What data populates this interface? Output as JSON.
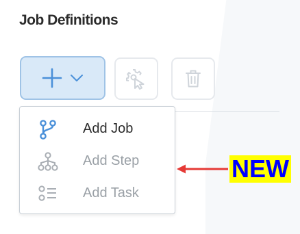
{
  "header": {
    "title": "Job Definitions"
  },
  "toolbar": {
    "add_button": {
      "icon": "plus-icon",
      "dropdown_icon": "chevron-down-icon",
      "color": "#4a90d9"
    },
    "settings_button": {
      "icon": "gear-arrow-icon",
      "enabled": false
    },
    "delete_button": {
      "icon": "trash-icon",
      "enabled": false
    }
  },
  "add_menu": {
    "items": [
      {
        "label": "Add Job",
        "icon": "branch-icon",
        "enabled": true
      },
      {
        "label": "Add Step",
        "icon": "hierarchy-icon",
        "enabled": false
      },
      {
        "label": "Add Task",
        "icon": "task-list-icon",
        "enabled": false
      }
    ]
  },
  "annotation": {
    "text": "NEW",
    "text_color": "#0000ff",
    "highlight_color": "#ffff00",
    "arrow_color": "#e53935"
  }
}
